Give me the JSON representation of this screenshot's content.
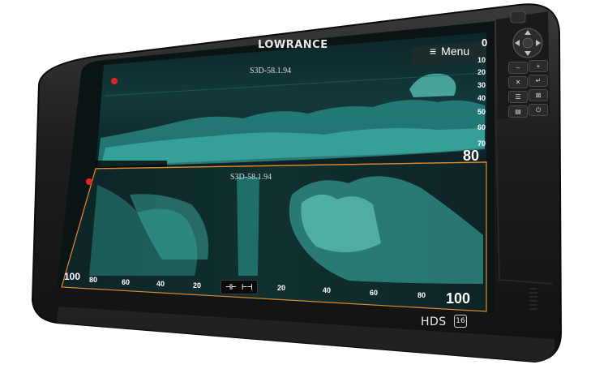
{
  "device": {
    "brand": "LOWRANCE",
    "model": "HDS",
    "model_number": "16",
    "menu_label": "Menu",
    "menu_icon": "hamburger-icon"
  },
  "top_panel": {
    "source_label": "S3D-58.1.94",
    "depth_scale": [
      "10",
      "20",
      "30",
      "40",
      "50",
      "60",
      "70"
    ],
    "max_depth": "80",
    "top_digit": "0"
  },
  "bottom_panel": {
    "source_label": "S3D-58.1.94",
    "left_scale": [
      "100",
      "80",
      "60",
      "40",
      "20"
    ],
    "right_scale": [
      "20",
      "40",
      "60",
      "80",
      "100"
    ],
    "toggle_icon": "side-scan-toggle-icon"
  },
  "keypad": {
    "labels": [
      "–",
      "+",
      "✕",
      "↵",
      "☰",
      "⊠",
      "▤",
      "⏻"
    ],
    "dpad_icon": "dpad-icon",
    "power_icon": "power-icon"
  },
  "colors": {
    "sonar_base": "#0f2a2c",
    "sonar_teal": "#33b8b0",
    "highlight": "#e08a2c",
    "bezel": "#1b1b1b"
  }
}
